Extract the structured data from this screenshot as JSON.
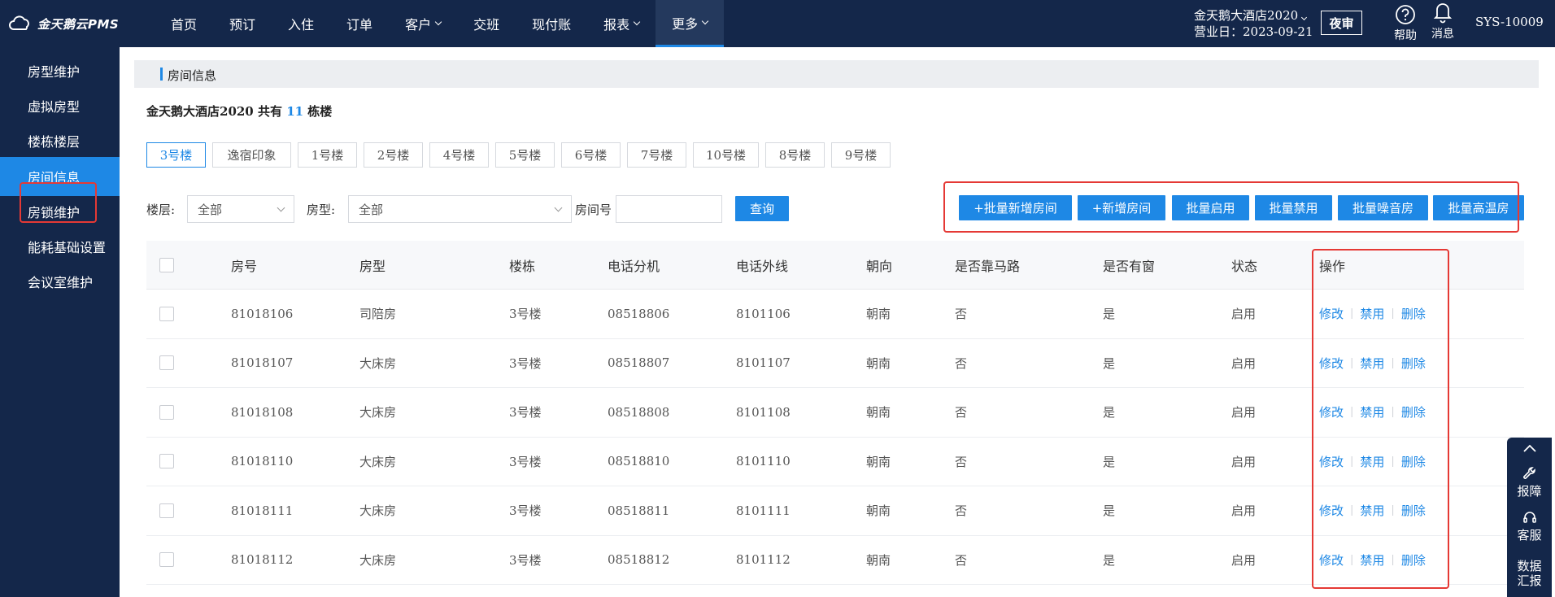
{
  "app": {
    "logo_text": "金天鹅云PMS"
  },
  "nav": {
    "items": [
      {
        "label": "首页",
        "dropdown": false
      },
      {
        "label": "预订",
        "dropdown": false
      },
      {
        "label": "入住",
        "dropdown": false
      },
      {
        "label": "订单",
        "dropdown": false
      },
      {
        "label": "客户",
        "dropdown": true
      },
      {
        "label": "交班",
        "dropdown": false
      },
      {
        "label": "现付账",
        "dropdown": false
      },
      {
        "label": "报表",
        "dropdown": true
      },
      {
        "label": "更多",
        "dropdown": true,
        "active": true
      }
    ]
  },
  "header": {
    "hotel_name": "金天鹅大酒店2020",
    "business_date": "营业日：2023-09-21",
    "night_audit": "夜审",
    "help": "帮助",
    "messages": "消息",
    "user": "SYS-10009"
  },
  "sidebar": {
    "items": [
      {
        "label": "房型维护"
      },
      {
        "label": "虚拟房型"
      },
      {
        "label": "楼栋楼层"
      },
      {
        "label": "房间信息",
        "active": true
      },
      {
        "label": "房锁维护"
      },
      {
        "label": "能耗基础设置"
      },
      {
        "label": "会议室维护"
      }
    ]
  },
  "main": {
    "title": "房间信息",
    "summary_prefix": "金天鹅大酒店2020 共有 ",
    "summary_count": "11",
    "summary_suffix": " 栋楼",
    "buildings": [
      "3号楼",
      "逸宿印象",
      "1号楼",
      "2号楼",
      "4号楼",
      "5号楼",
      "6号楼",
      "7号楼",
      "10号楼",
      "8号楼",
      "9号楼"
    ],
    "active_building": "3号楼",
    "filters": {
      "floor_label": "楼层:",
      "floor_value": "全部",
      "roomtype_label": "房型:",
      "roomtype_value": "全部",
      "roomno_label": "房间号",
      "roomno_value": "",
      "search_button": "查询"
    },
    "actions": {
      "batch_add": "+批量新增房间",
      "add": "+新增房间",
      "batch_enable": "批量启用",
      "batch_disable": "批量禁用",
      "batch_noise": "批量噪音房",
      "batch_temp": "批量高温房"
    },
    "table": {
      "headers": [
        "房号",
        "房型",
        "楼栋",
        "电话分机",
        "电话外线",
        "朝向",
        "是否靠马路",
        "是否有窗",
        "状态",
        "操作"
      ],
      "action_labels": {
        "edit": "修改",
        "disable": "禁用",
        "delete": "删除"
      },
      "rows": [
        [
          "81018106",
          "司陪房",
          "3号楼",
          "08518806",
          "8101106",
          "朝南",
          "否",
          "是",
          "启用"
        ],
        [
          "81018107",
          "大床房",
          "3号楼",
          "08518807",
          "8101107",
          "朝南",
          "否",
          "是",
          "启用"
        ],
        [
          "81018108",
          "大床房",
          "3号楼",
          "08518808",
          "8101108",
          "朝南",
          "否",
          "是",
          "启用"
        ],
        [
          "81018110",
          "大床房",
          "3号楼",
          "08518810",
          "8101110",
          "朝南",
          "否",
          "是",
          "启用"
        ],
        [
          "81018111",
          "大床房",
          "3号楼",
          "08518811",
          "8101111",
          "朝南",
          "否",
          "是",
          "启用"
        ],
        [
          "81018112",
          "大床房",
          "3号楼",
          "08518812",
          "8101112",
          "朝南",
          "否",
          "是",
          "启用"
        ]
      ]
    }
  },
  "float_panel": {
    "report_issue": "报障",
    "customer_service": "客服",
    "data_report": "数据汇报"
  },
  "colors": {
    "nav_bg": "#14274a",
    "accent": "#1e88e5",
    "highlight_box": "#e53935"
  }
}
